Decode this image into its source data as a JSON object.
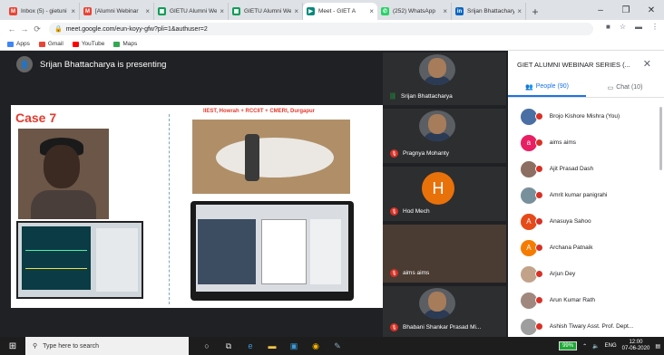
{
  "browser": {
    "tabs": [
      {
        "title": "Inbox (5) - gietuni",
        "fav_color": "#ea4335",
        "fav_glyph": "M",
        "active": false
      },
      {
        "title": "[Alumni Webinar",
        "fav_color": "#ea4335",
        "fav_glyph": "M",
        "active": false
      },
      {
        "title": "GIETU Alumni We",
        "fav_color": "#0f9d58",
        "fav_glyph": "▦",
        "active": false
      },
      {
        "title": "GIETU Alumni We",
        "fav_color": "#0f9d58",
        "fav_glyph": "▦",
        "active": false
      },
      {
        "title": "Meet - GIET A",
        "fav_color": "#00897b",
        "fav_glyph": "▶",
        "active": true
      },
      {
        "title": "(252) WhatsApp",
        "fav_color": "#25d366",
        "fav_glyph": "✆",
        "active": false
      },
      {
        "title": "Srijan Bhattacharya",
        "fav_color": "#0a66c2",
        "fav_glyph": "in",
        "active": false
      }
    ],
    "tab_close": "×",
    "new_tab": "+",
    "window_controls": {
      "minimize": "–",
      "maximize": "❐",
      "close": "✕"
    },
    "url": "meet.google.com/eun-koyy-gfw?pli=1&authuser=2",
    "bookmarks": [
      {
        "label": "Apps",
        "color": "#4285f4"
      },
      {
        "label": "Gmail",
        "color": "#ea4335"
      },
      {
        "label": "YouTube",
        "color": "#ff0000"
      },
      {
        "label": "Maps",
        "color": "#34a853"
      }
    ]
  },
  "meet": {
    "presenter_banner": "Srijan Bhattacharya is presenting",
    "slide": {
      "case_label": "Case 7",
      "title": "IIEST, Howrah + RCCIIT + CMERI, Durgapur"
    },
    "tiles": [
      {
        "name": "Srijan Bhattacharya",
        "muted": false,
        "kind": "video"
      },
      {
        "name": "Pragnya Mohanty",
        "muted": true,
        "kind": "video"
      },
      {
        "name": "Hod Mech",
        "muted": true,
        "kind": "letter",
        "letter": "H",
        "color": "#e8710a"
      },
      {
        "name": "aims aims",
        "muted": true,
        "kind": "blank"
      },
      {
        "name": "Bhabani Shankar Prasad Mi...",
        "muted": true,
        "kind": "video"
      }
    ],
    "panel": {
      "title": "GIET ALUMNI WEBINAR SERIES (...",
      "close": "✕",
      "people_tab": "People (90)",
      "chat_tab": "Chat (10)",
      "participants": [
        {
          "name": "Brojo Kishore Mishra (You)",
          "avatar": "photo",
          "color": "#4a6fa5"
        },
        {
          "name": "aims aims",
          "avatar": "letter",
          "letter": "a",
          "color": "#e91e63"
        },
        {
          "name": "Ajit Prasad Dash",
          "avatar": "photo",
          "color": "#8d6e63"
        },
        {
          "name": "Amrit kumar panigrahi",
          "avatar": "photo",
          "color": "#78909c"
        },
        {
          "name": "Anasuya Sahoo",
          "avatar": "letter",
          "letter": "A",
          "color": "#e64a19"
        },
        {
          "name": "Archana Patnaik",
          "avatar": "letter",
          "letter": "A",
          "color": "#f57c00"
        },
        {
          "name": "Arjun Dey",
          "avatar": "photo",
          "color": "#c2a38a"
        },
        {
          "name": "Arun Kumar Rath",
          "avatar": "photo",
          "color": "#a1887f"
        },
        {
          "name": "Ashish Tiwary Asst. Prof. Dept...",
          "avatar": "photo",
          "color": "#9e9e9e"
        }
      ]
    }
  },
  "taskbar": {
    "search_placeholder": "Type here to search",
    "battery": "99%",
    "lang": "ENG",
    "time": "12:00",
    "date": "07-06-2020"
  }
}
